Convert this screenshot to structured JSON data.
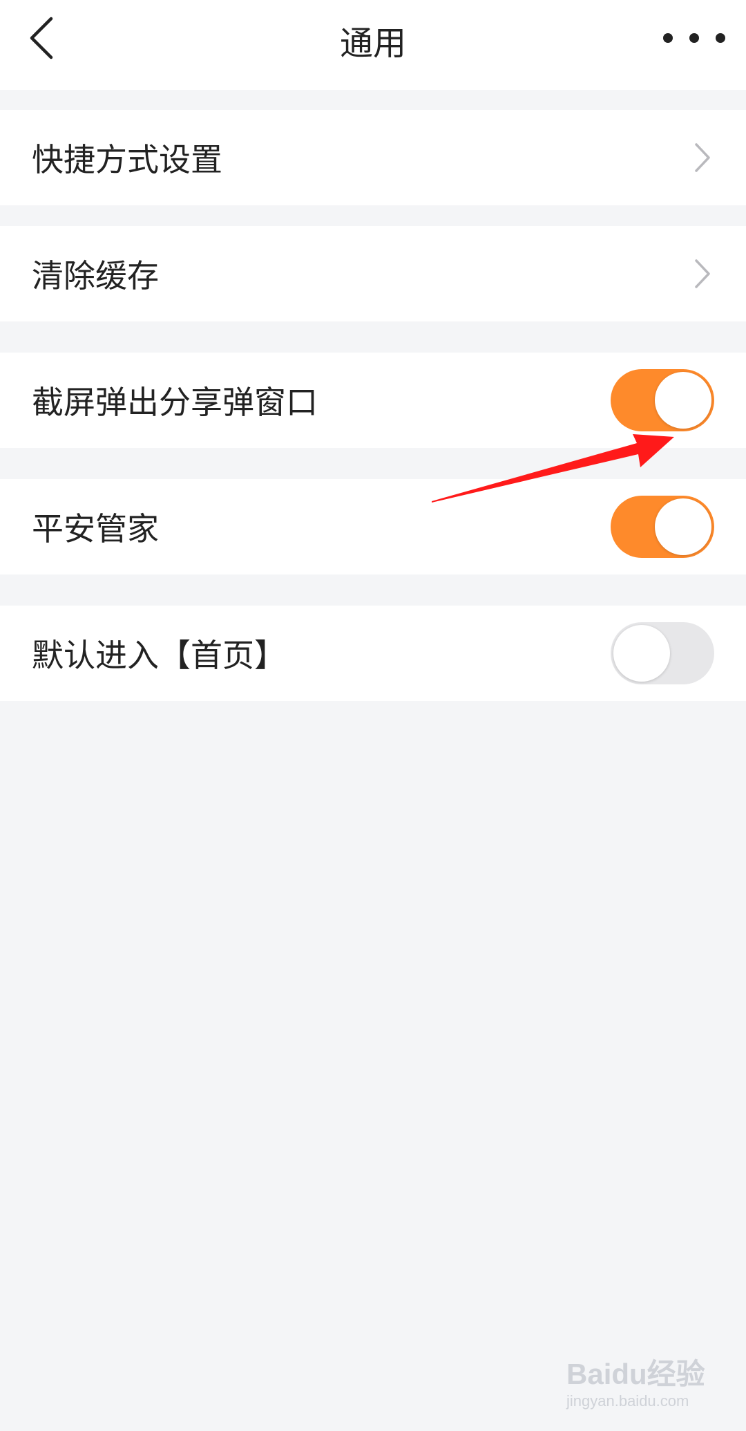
{
  "header": {
    "title": "通用",
    "back_icon": "chevron-left-icon",
    "more_icon": "more-horizontal-icon"
  },
  "settings": [
    {
      "label": "快捷方式设置",
      "control": "chevron"
    },
    {
      "label": "清除缓存",
      "control": "chevron"
    },
    {
      "label": "截屏弹出分享弹窗口",
      "control": "toggle",
      "on": true
    },
    {
      "label": "平安管家",
      "control": "toggle",
      "on": true
    },
    {
      "label": "默认进入【首页】",
      "control": "toggle",
      "on": false
    }
  ],
  "colors": {
    "accent": "#fe8a2b",
    "toggle_off": "#e7e7e9",
    "background": "#f4f5f7",
    "annotation_arrow": "#ff1a1a"
  },
  "watermark": {
    "main": "Baidu经验",
    "sub": "jingyan.baidu.com"
  }
}
